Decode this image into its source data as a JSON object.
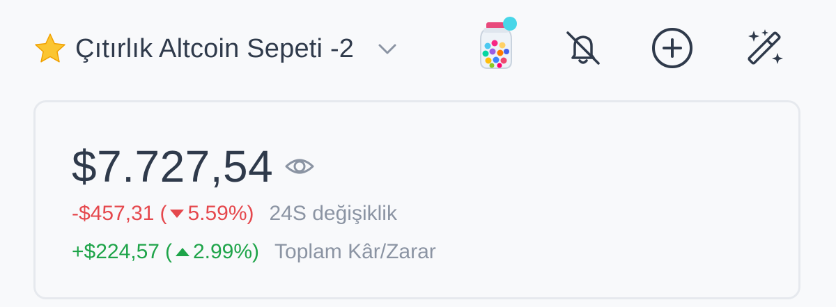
{
  "header": {
    "title": "Çıtırlık Altcoin Sepeti -2",
    "icons": {
      "favorite": "star-icon",
      "dropdown": "chevron-down-icon",
      "avatar": "candy-jar-icon",
      "alerts": "bell-off-icon",
      "add": "add-circle-icon",
      "ai": "magic-wand-icon"
    }
  },
  "balance": {
    "total": "$7.727,54",
    "visibility_icon": "eye-icon"
  },
  "change_24h": {
    "amount": "-$457,31",
    "open": "(",
    "percent": "5.59%",
    "close": ")",
    "label": "24S değişiklik",
    "direction": "down"
  },
  "total_pnl": {
    "amount": "+$224,57",
    "open": "(",
    "percent": "2.99%",
    "close": ")",
    "label": "Toplam Kâr/Zarar",
    "direction": "up"
  },
  "colors": {
    "text": "#2f3a4b",
    "muted": "#8b94a3",
    "negative": "#e5484d",
    "positive": "#1ea449",
    "background": "#f8f9fb",
    "card_border": "#e6e9ee"
  }
}
